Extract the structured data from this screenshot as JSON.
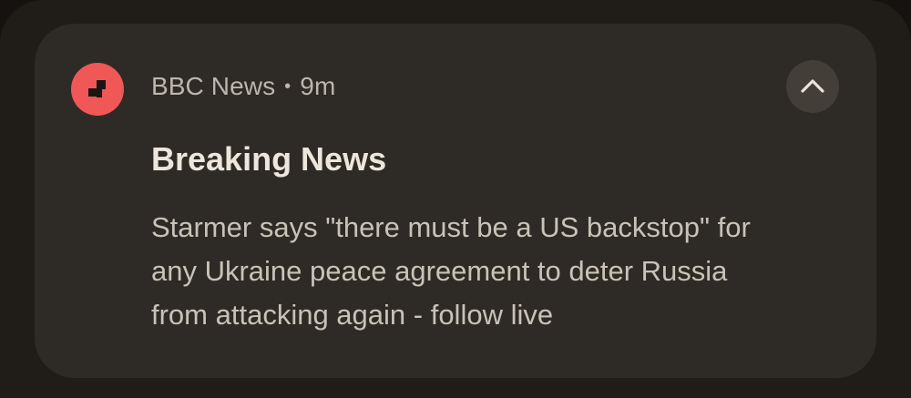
{
  "notification": {
    "app_name": "BBC News",
    "separator": "•",
    "time_ago": "9m",
    "app_icon": "bbc-news-icon",
    "expand_icon": "chevron-up-icon",
    "title": "Breaking News",
    "body_lines": [
      "Starmer says \"there must be a US backstop\" for",
      "any Ukraine peace agreement to deter Russia",
      "from attacking again - follow live"
    ]
  },
  "colors": {
    "background": "#15120f",
    "card": "#2e2a25",
    "icon_accent": "#ef5856",
    "expand_button": "#433e38",
    "title_text": "#ece6dc",
    "body_text": "#c9c2b7"
  }
}
